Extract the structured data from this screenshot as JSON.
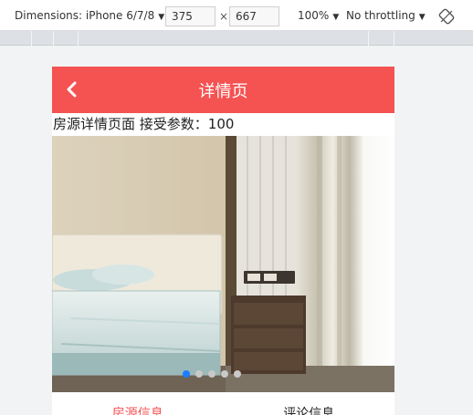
{
  "devtools": {
    "dimensions_label": "Dimensions: iPhone 6/7/8",
    "width": "375",
    "times": "×",
    "height": "667",
    "zoom": "100%",
    "throttling": "No throttling",
    "dropdown_glyph": "▼"
  },
  "header": {
    "title": "详情页",
    "back_icon": "chevron-left-icon"
  },
  "content": {
    "param_text": "房源详情页面 接受参数：100"
  },
  "carousel": {
    "active_index": 0,
    "dot_count": 5
  },
  "tabs": [
    {
      "label": "房源信息",
      "active": true
    },
    {
      "label": "评论信息",
      "active": false
    }
  ],
  "colors": {
    "accent": "#f55252",
    "dot_active": "#1a7dff"
  }
}
